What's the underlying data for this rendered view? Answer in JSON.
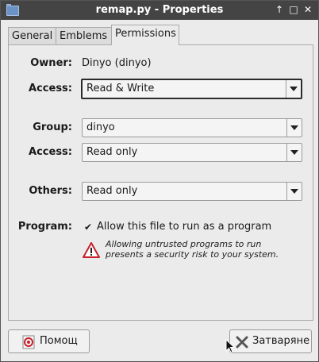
{
  "window": {
    "title": "remap.py - Properties",
    "buttons": [
      "↑",
      "□",
      "✕"
    ]
  },
  "tabs": [
    {
      "label": "General",
      "active": false
    },
    {
      "label": "Emblems",
      "active": false
    },
    {
      "label": "Permissions",
      "active": true
    }
  ],
  "permissions": {
    "owner_label": "Owner:",
    "owner_value": "Dinyo (dinyo)",
    "owner_access_label": "Access:",
    "owner_access_value": "Read & Write",
    "group_label": "Group:",
    "group_value": "dinyo",
    "group_access_label": "Access:",
    "group_access_value": "Read only",
    "others_label": "Others:",
    "others_value": "Read only",
    "program_label": "Program:",
    "program_checkbox_label": "Allow this file to run as a program",
    "program_checked": true,
    "warning_line1": "Allowing untrusted programs to run",
    "warning_line2": "presents a security risk to your system."
  },
  "footer": {
    "help_label": "Помощ",
    "close_label": "Затваряне"
  },
  "colors": {
    "titlebar": "#444444",
    "warning": "#c8202a"
  }
}
